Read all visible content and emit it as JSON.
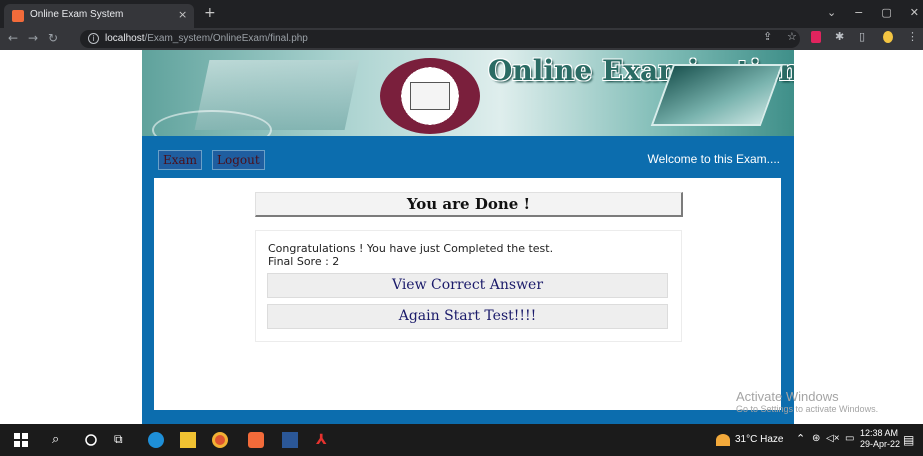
{
  "browser": {
    "tab_title": "Online Exam System",
    "tab_close": "×",
    "new_tab": "+",
    "url_host": "localhost",
    "url_path": "/Exam_system/OnlineExam/final.php"
  },
  "header": {
    "title": "Online Examination"
  },
  "nav": {
    "exam_label": "Exam",
    "logout_label": "Logout",
    "welcome_text": "Welcome to this Exam...."
  },
  "result": {
    "heading": "You are Done !",
    "congrats_text": "Congratulations ! You have just Completed the test.",
    "score_text": "Final Sore : 2",
    "view_answer_label": "View Correct Answer",
    "restart_label": "Again Start Test!!!!"
  },
  "watermark": {
    "line1": "Activate Windows",
    "line2": "Go to Settings to activate Windows."
  },
  "taskbar": {
    "weather": "31°C  Haze",
    "time": "12:38 AM",
    "date": "29-Apr-22"
  },
  "colors": {
    "frame_blue": "#0c6dae",
    "banner_green": "#2a6b64",
    "button_bg": "#eeeeee"
  }
}
